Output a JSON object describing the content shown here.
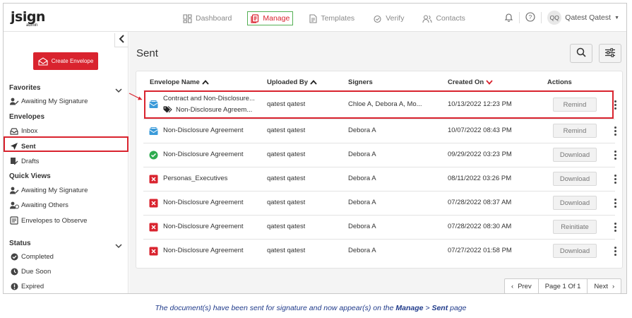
{
  "brand": {
    "logo": "jsign",
    "logo_sub": "admin"
  },
  "colors": {
    "accent": "#d9232e",
    "active_nav_border": "#54b054",
    "caption": "#1f3a8a"
  },
  "nav": {
    "items": [
      {
        "label": "Dashboard",
        "icon": "dashboard-icon"
      },
      {
        "label": "Manage",
        "icon": "manage-icon",
        "active": true
      },
      {
        "label": "Templates",
        "icon": "templates-icon"
      },
      {
        "label": "Verify",
        "icon": "verify-icon"
      },
      {
        "label": "Contacts",
        "icon": "contacts-icon"
      }
    ],
    "user": {
      "initials": "QQ",
      "name": "Qatest Qatest"
    }
  },
  "sidebar": {
    "create_label": "Create Envelope",
    "favorites": {
      "title": "Favorites",
      "items": [
        "Awaiting My Signature"
      ]
    },
    "envelopes": {
      "title": "Envelopes",
      "items": [
        "Inbox",
        "Sent",
        "Drafts"
      ]
    },
    "quick_views": {
      "title": "Quick Views",
      "items": [
        "Awaiting My Signature",
        "Awaiting Others",
        "Envelopes to Observe"
      ]
    },
    "status": {
      "title": "Status",
      "items": [
        "Completed",
        "Due Soon",
        "Expired"
      ]
    }
  },
  "main": {
    "title": "Sent",
    "columns": [
      "Envelope Name",
      "Uploaded By",
      "Signers",
      "Created On",
      "Actions"
    ],
    "rows": [
      {
        "status": "sent",
        "name": "Contract and Non-Disclosure...",
        "sub": "Non-Disclosure Agreem...",
        "uploaded_by": "qatest qatest",
        "signers": "Chloe A, Debora A, Mo...",
        "created": "10/13/2022 12:23 PM",
        "action": "Remind"
      },
      {
        "status": "sent",
        "name": "Non-Disclosure Agreement",
        "uploaded_by": "qatest qatest",
        "signers": "Debora A",
        "created": "10/07/2022 08:43 PM",
        "action": "Remind"
      },
      {
        "status": "completed",
        "name": "Non-Disclosure Agreement",
        "uploaded_by": "qatest qatest",
        "signers": "Debora A",
        "created": "09/29/2022 03:23 PM",
        "action": "Download"
      },
      {
        "status": "declined",
        "name": "Personas_Executives",
        "uploaded_by": "qatest qatest",
        "signers": "Debora A",
        "created": "08/11/2022 03:26 PM",
        "action": "Download"
      },
      {
        "status": "declined",
        "name": "Non-Disclosure Agreement",
        "uploaded_by": "qatest qatest",
        "signers": "Debora A",
        "created": "07/28/2022 08:37 AM",
        "action": "Download"
      },
      {
        "status": "declined",
        "name": "Non-Disclosure Agreement",
        "uploaded_by": "qatest qatest",
        "signers": "Debora A",
        "created": "07/28/2022 08:30 AM",
        "action": "Reinitiate"
      },
      {
        "status": "declined",
        "name": "Non-Disclosure Agreement",
        "uploaded_by": "qatest qatest",
        "signers": "Debora A",
        "created": "07/27/2022 01:58 PM",
        "action": "Download"
      }
    ],
    "pager": {
      "prev": "Prev",
      "page": "Page 1 Of 1",
      "next": "Next"
    }
  },
  "caption": {
    "pre": "The document(s) have been sent for signature and now appear(s) on the ",
    "manage": "Manage",
    "sep": " > ",
    "sent": "Sent",
    "post": " page"
  }
}
